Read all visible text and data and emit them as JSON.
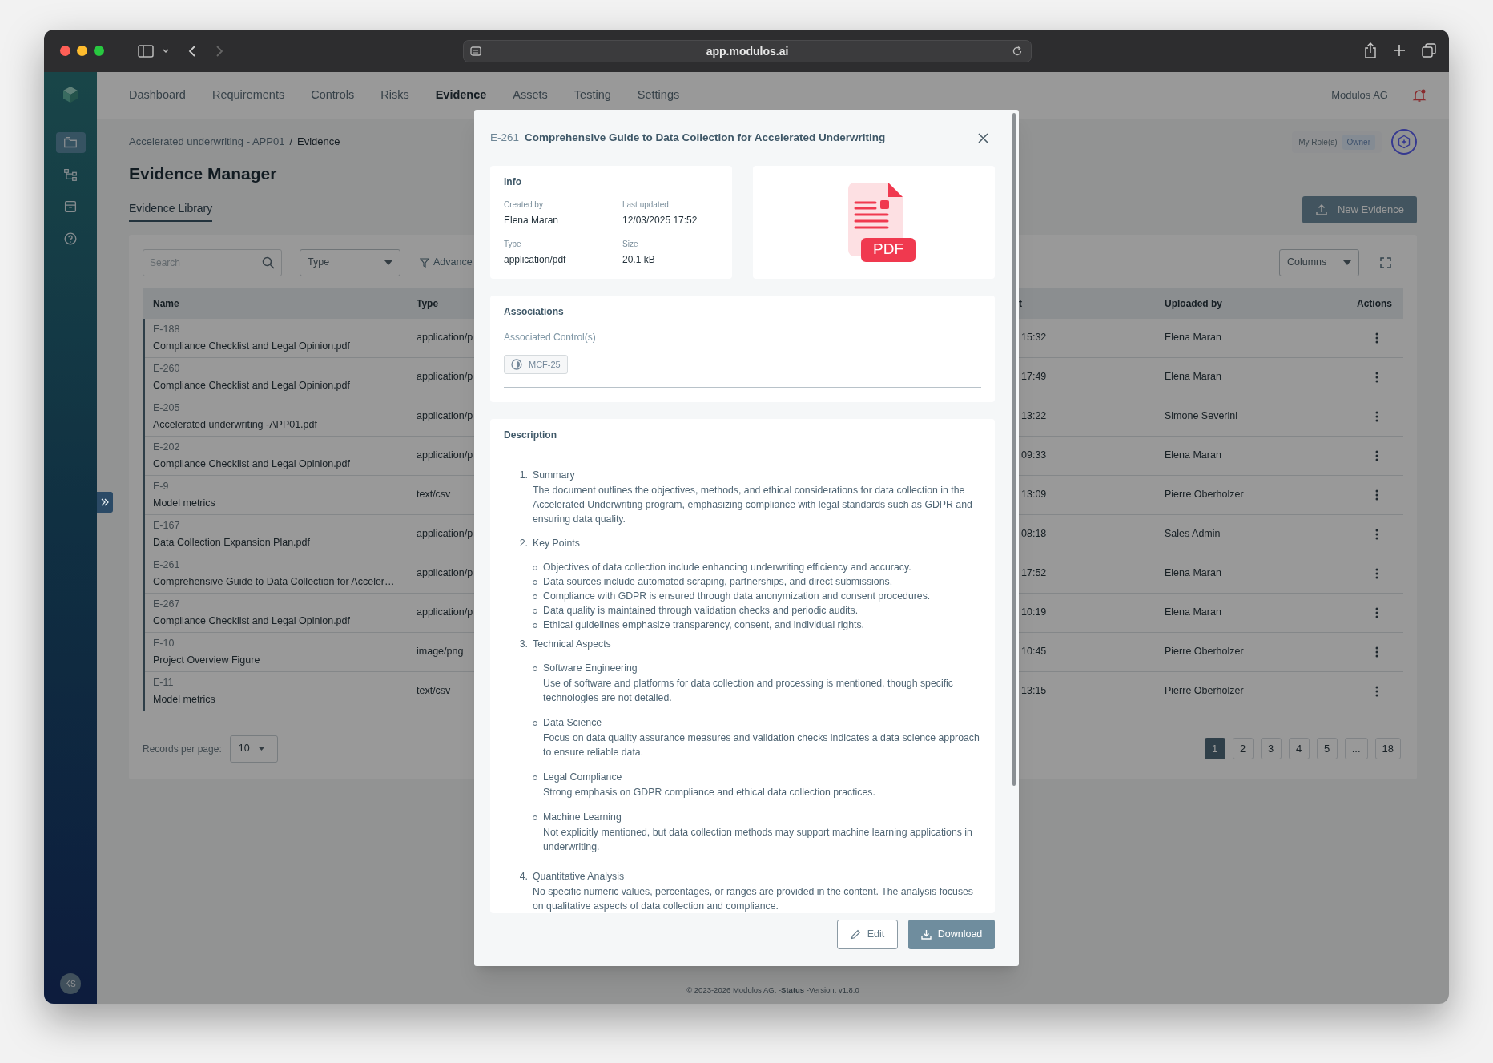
{
  "browser": {
    "url": "app.modulos.ai"
  },
  "sidebar": {
    "items": [
      {
        "selected": true
      },
      {
        "selected": false
      },
      {
        "selected": false
      },
      {
        "selected": false
      }
    ],
    "avatar": "KS"
  },
  "nav": {
    "items": [
      {
        "label": "Dashboard",
        "selected": false
      },
      {
        "label": "Requirements",
        "selected": false
      },
      {
        "label": "Controls",
        "selected": false
      },
      {
        "label": "Risks",
        "selected": false
      },
      {
        "label": "Evidence",
        "selected": true
      },
      {
        "label": "Assets",
        "selected": false
      },
      {
        "label": "Testing",
        "selected": false
      },
      {
        "label": "Settings",
        "selected": false
      }
    ],
    "org": "Modulos AG"
  },
  "breadcrumb": [
    "Accelerated underwriting - APP01",
    "Evidence"
  ],
  "breadcrumb_separator": "/",
  "role": {
    "label": "My Role(s)",
    "value": "Owner"
  },
  "page_title": "Evidence Manager",
  "tabs": [
    {
      "label": "Evidence Library",
      "selected": true
    }
  ],
  "new_button": "New Evidence",
  "toolbar": {
    "search_placeholder": "Search",
    "type_filter": "Type",
    "advanced": "Advance",
    "columns": "Columns"
  },
  "table": {
    "columns": [
      "Name",
      "Type",
      "t",
      "Uploaded by",
      "Actions"
    ],
    "rows": [
      {
        "id": "E-188",
        "name": "Compliance Checklist and Legal Opinion.pdf",
        "type": "application/p",
        "column_3": "15:32",
        "uploaded_by": "Elena Maran"
      },
      {
        "id": "E-260",
        "name": "Compliance Checklist and Legal Opinion.pdf",
        "type": "application/p",
        "column_3": "17:49",
        "uploaded_by": "Elena Maran"
      },
      {
        "id": "E-205",
        "name": "Accelerated underwriting -APP01.pdf",
        "type": "application/p",
        "column_3": "13:22",
        "uploaded_by": "Simone Severini"
      },
      {
        "id": "E-202",
        "name": "Compliance Checklist and Legal Opinion.pdf",
        "type": "application/p",
        "column_3": "09:33",
        "uploaded_by": "Elena Maran"
      },
      {
        "id": "E-9",
        "name": "Model metrics",
        "type": "text/csv",
        "column_3": "13:09",
        "uploaded_by": "Pierre Oberholzer"
      },
      {
        "id": "E-167",
        "name": "Data Collection Expansion Plan.pdf",
        "type": "application/p",
        "column_3": "08:18",
        "uploaded_by": "Sales Admin"
      },
      {
        "id": "E-261",
        "name": "Comprehensive Guide to Data Collection for Acceler…",
        "type": "application/p",
        "column_3": "17:52",
        "uploaded_by": "Elena Maran"
      },
      {
        "id": "E-267",
        "name": "Compliance Checklist and Legal Opinion.pdf",
        "type": "application/p",
        "column_3": "10:19",
        "uploaded_by": "Elena Maran"
      },
      {
        "id": "E-10",
        "name": "Project Overview Figure",
        "type": "image/png",
        "column_3": "10:45",
        "uploaded_by": "Pierre Oberholzer"
      },
      {
        "id": "E-11",
        "name": "Model metrics",
        "type": "text/csv",
        "column_3": "13:15",
        "uploaded_by": "Pierre Oberholzer"
      }
    ]
  },
  "records_per_page": {
    "label": "Records per page:",
    "value": "10"
  },
  "pagination": [
    {
      "label": "1",
      "selected": true
    },
    {
      "label": "2",
      "selected": false
    },
    {
      "label": "3",
      "selected": false
    },
    {
      "label": "4",
      "selected": false
    },
    {
      "label": "5",
      "selected": false
    },
    {
      "label": "...",
      "selected": false
    },
    {
      "label": "18",
      "selected": false
    }
  ],
  "footer": "© 2023-2026 Modulos AG. -**Status** -Version: v1.8.0",
  "modal": {
    "id": "E-261",
    "title": "Comprehensive Guide to Data Collection for Accelerated Underwriting",
    "info": {
      "heading": "Info",
      "fields": [
        {
          "label": "Created by",
          "value": "Elena Maran"
        },
        {
          "label": "Last updated",
          "value": "12/03/2025 17:52"
        },
        {
          "label": "Type",
          "value": "application/pdf"
        },
        {
          "label": "Size",
          "value": "20.1 kB"
        }
      ]
    },
    "preview": {
      "badge": "PDF"
    },
    "associations": {
      "heading": "Associations",
      "label": "Associated Control(s)",
      "controls": [
        "MCF-25"
      ]
    },
    "description": {
      "heading": "Description",
      "sections": [
        {
          "number": "1.",
          "heading": "Summary",
          "body": "The document outlines the objectives, methods, and ethical considerations for data collection in the Accelerated Underwriting program, emphasizing compliance with legal standards such as GDPR and ensuring data quality."
        },
        {
          "number": "2.",
          "heading": "Key Points",
          "points": [
            {
              "body": "Objectives of data collection include enhancing underwriting efficiency and accuracy."
            },
            {
              "body": "Data sources include automated scraping, partnerships, and direct submissions."
            },
            {
              "body": "Compliance with GDPR is ensured through data anonymization and consent procedures."
            },
            {
              "body": "Data quality is maintained through validation checks and periodic audits."
            },
            {
              "body": "Ethical guidelines emphasize transparency, consent, and individual rights."
            }
          ]
        },
        {
          "number": "3.",
          "heading": "Technical Aspects",
          "points": [
            {
              "heading": "Software Engineering",
              "body": "Use of software and platforms for data collection and processing is mentioned, though specific technologies are not detailed."
            },
            {
              "heading": "Data Science",
              "body": "Focus on data quality assurance measures and validation checks indicates a data science approach to ensure reliable data."
            },
            {
              "heading": "Legal Compliance",
              "body": "Strong emphasis on GDPR compliance and ethical data collection practices."
            },
            {
              "heading": "Machine Learning",
              "body": "Not explicitly mentioned, but data collection methods may support machine learning applications in underwriting."
            }
          ]
        },
        {
          "number": "4.",
          "heading": "Quantitative Analysis",
          "body": "No specific numeric values, percentages, or ranges are provided in the content. The analysis focuses on qualitative aspects of data collection and compliance."
        }
      ]
    },
    "buttons": {
      "edit": "Edit",
      "download": "Download"
    }
  }
}
